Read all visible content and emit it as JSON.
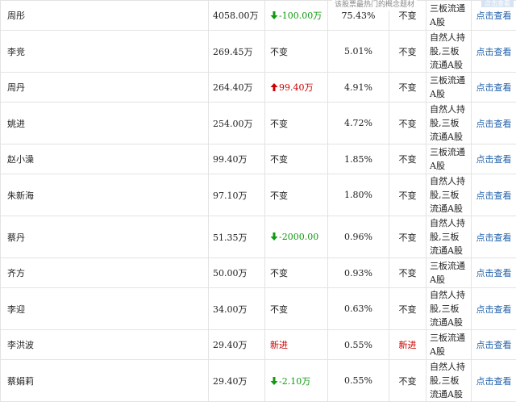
{
  "tooltip": "该股票最热门的概念题材",
  "corner_button": "点击查看",
  "rows": [
    {
      "name": "周彤",
      "shares": "4058.00万",
      "change": "-100.00万",
      "dir": "down",
      "ratio": "75.43%",
      "status": "不变",
      "type": "三板流通A股",
      "link": "点击查看"
    },
    {
      "name": "李竞",
      "shares": "269.45万",
      "change": "不变",
      "dir": "none",
      "ratio": "5.01%",
      "status": "不变",
      "type": "自然人持股,三板流通A股",
      "link": "点击查看"
    },
    {
      "name": "周丹",
      "shares": "264.40万",
      "change": "99.40万",
      "dir": "up",
      "ratio": "4.91%",
      "status": "不变",
      "type": "三板流通A股",
      "link": "点击查看"
    },
    {
      "name": "姚进",
      "shares": "254.00万",
      "change": "不变",
      "dir": "none",
      "ratio": "4.72%",
      "status": "不变",
      "type": "自然人持股,三板流通A股",
      "link": "点击查看"
    },
    {
      "name": "赵小澡",
      "shares": "99.40万",
      "change": "不变",
      "dir": "none",
      "ratio": "1.85%",
      "status": "不变",
      "type": "三板流通A股",
      "link": "点击查看"
    },
    {
      "name": "朱新海",
      "shares": "97.10万",
      "change": "不变",
      "dir": "none",
      "ratio": "1.80%",
      "status": "不变",
      "type": "自然人持股,三板流通A股",
      "link": "点击查看"
    },
    {
      "name": "蔡丹",
      "shares": "51.35万",
      "change": "-2000.00",
      "dir": "down",
      "ratio": "0.96%",
      "status": "不变",
      "type": "自然人持股,三板流通A股",
      "link": "点击查看"
    },
    {
      "name": "齐方",
      "shares": "50.00万",
      "change": "不变",
      "dir": "none",
      "ratio": "0.93%",
      "status": "不变",
      "type": "三板流通A股",
      "link": "点击查看"
    },
    {
      "name": "李迎",
      "shares": "34.00万",
      "change": "不变",
      "dir": "none",
      "ratio": "0.63%",
      "status": "不变",
      "type": "自然人持股,三板流通A股",
      "link": "点击查看"
    },
    {
      "name": "李洪波",
      "shares": "29.40万",
      "change": "新进",
      "dir": "new",
      "ratio": "0.55%",
      "status": "新进",
      "status_dir": "new",
      "type": "三板流通A股",
      "link": "点击查看"
    },
    {
      "name": "蔡娟莉",
      "shares": "29.40万",
      "change": "-2.10万",
      "dir": "down",
      "ratio": "0.55%",
      "status": "不变",
      "type": "自然人持股,三板流通A股",
      "link": "点击查看"
    }
  ]
}
